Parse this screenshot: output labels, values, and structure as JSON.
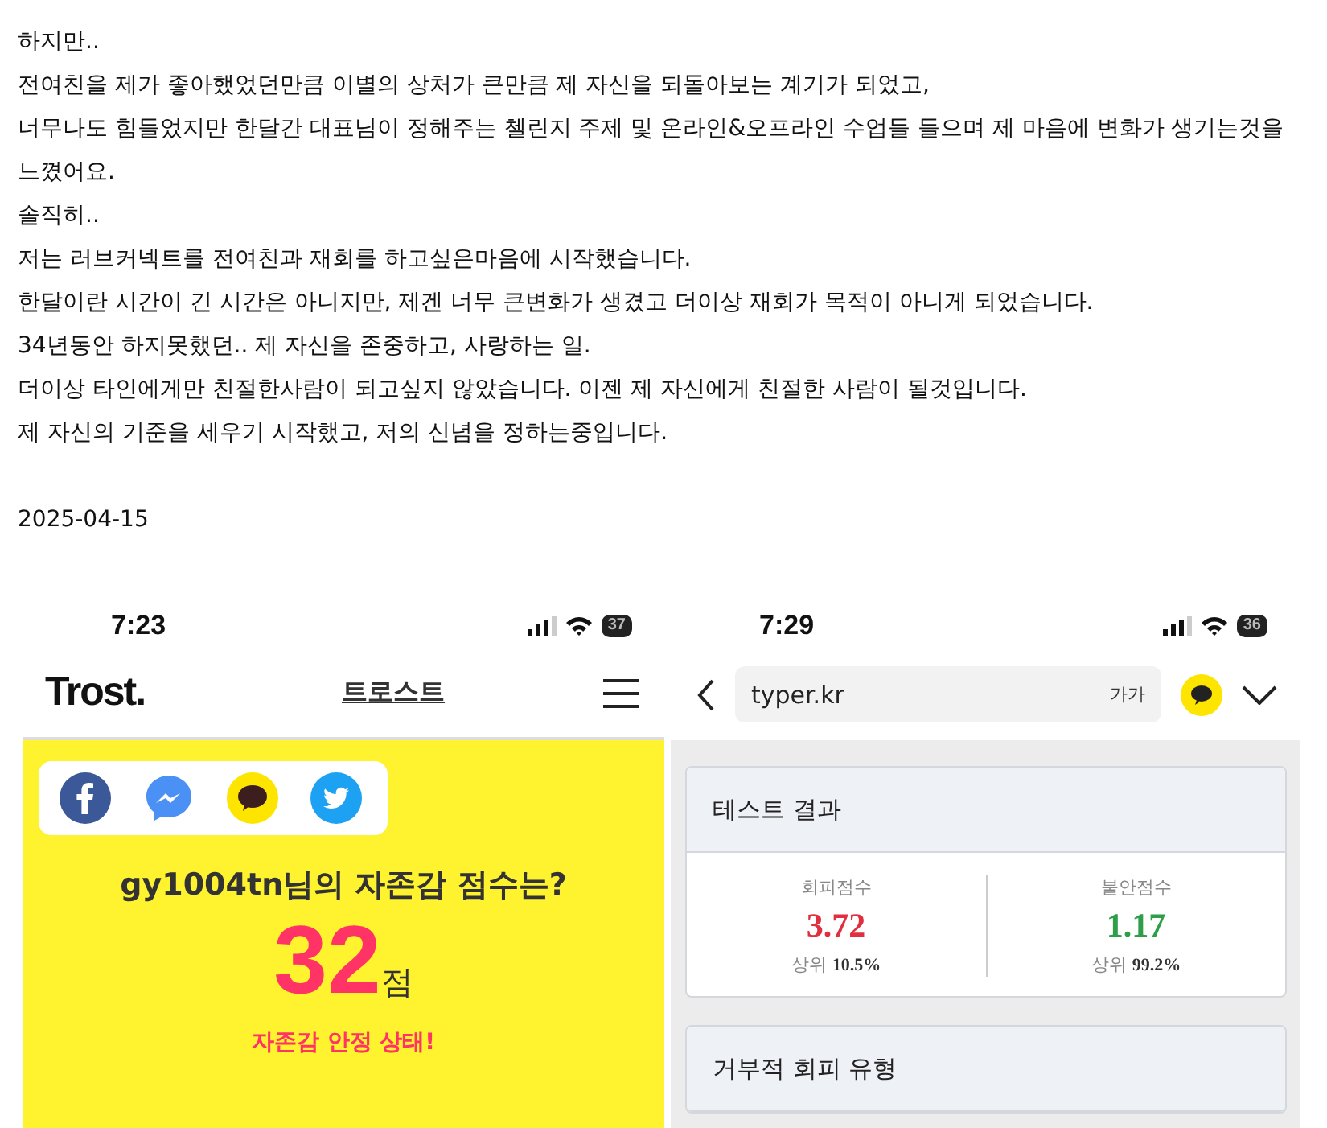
{
  "post": {
    "lines": [
      "하지만..",
      "전여친을 제가 좋아했었던만큼 이별의 상처가 큰만큼 제 자신을 되돌아보는 계기가 되었고,",
      "너무나도 힘들었지만 한달간 대표님이 정해주는 첼린지 주제 및 온라인&오프라인 수업들 들으며 제 마음에 변화가 생기는것을 느꼈어요.",
      "솔직히..",
      "저는 러브커넥트를 전여친과 재회를 하고싶은마음에 시작했습니다.",
      "한달이란 시간이 긴 시간은 아니지만, 제겐 너무 큰변화가 생겼고 더이상 재회가 목적이 아니게 되었습니다.",
      "34년동안 하지못했던.. 제 자신을 존중하고, 사랑하는 일.",
      "더이상 타인에게만 친절한사람이 되고싶지 않았습니다. 이젠 제 자신에게 친절한 사람이 될것입니다.",
      "제 자신의 기준을 세우기 시작했고, 저의 신념을 정하는중입니다."
    ],
    "date": "2025-04-15"
  },
  "left_phone": {
    "status_bar": {
      "time": "7:23",
      "battery": "37"
    },
    "header": {
      "logo": "Trost.",
      "title": "트로스트"
    },
    "share_buttons": [
      {
        "kind": "facebook"
      },
      {
        "kind": "messenger"
      },
      {
        "kind": "kakao"
      },
      {
        "kind": "twitter"
      }
    ],
    "result": {
      "question": "gy1004tn님의 자존감 점수는?",
      "score": "32",
      "unit": "점",
      "status": "자존감 안정 상태!"
    }
  },
  "right_phone": {
    "status_bar": {
      "time": "7:29",
      "battery": "36"
    },
    "address_bar": {
      "url": "typer.kr",
      "text_size": "가가"
    },
    "result_card": {
      "title": "테스트 결과",
      "scores": [
        {
          "label": "회피점수",
          "value": "3.72",
          "color": "#e0303f",
          "rank": "상위 **10.5%**"
        },
        {
          "label": "불안점수",
          "value": "1.17",
          "color": "#2e9e48",
          "rank": "상위 **99.2%**"
        }
      ]
    },
    "next_card": {
      "title": "거부적 회피 유형"
    }
  }
}
